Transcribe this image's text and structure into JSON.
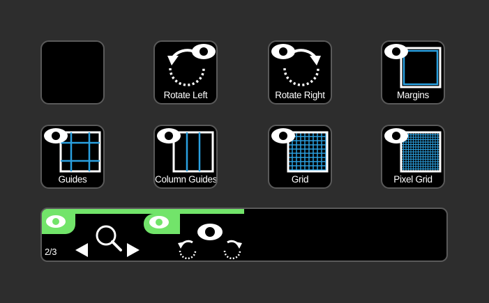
{
  "colors": {
    "background": "#2d2d2d",
    "button_fill": "#000000",
    "button_border": "#5a5a5a",
    "accent_blue": "#2aa0e0",
    "accent_green": "#72e46a",
    "icon_white": "#ffffff"
  },
  "buttons": {
    "empty": {
      "label": ""
    },
    "rotate_left": {
      "label": "Rotate Left",
      "icon": "rotate-left-icon"
    },
    "rotate_right": {
      "label": "Rotate Right",
      "icon": "rotate-right-icon"
    },
    "margins": {
      "label": "Margins",
      "icon": "margins-icon"
    },
    "guides": {
      "label": "Guides",
      "icon": "guides-icon"
    },
    "column_guides": {
      "label": "Column Guides",
      "icon": "column-guides-icon"
    },
    "grid": {
      "label": "Grid",
      "icon": "grid-icon"
    },
    "pixel_grid": {
      "label": "Pixel Grid",
      "icon": "pixel-grid-icon"
    }
  },
  "dial": {
    "page_indicator": "2/3",
    "progress": 0.5,
    "zoom_icon": "magnifier-icon",
    "rotate_view_icon": "rotate-view-icon"
  }
}
